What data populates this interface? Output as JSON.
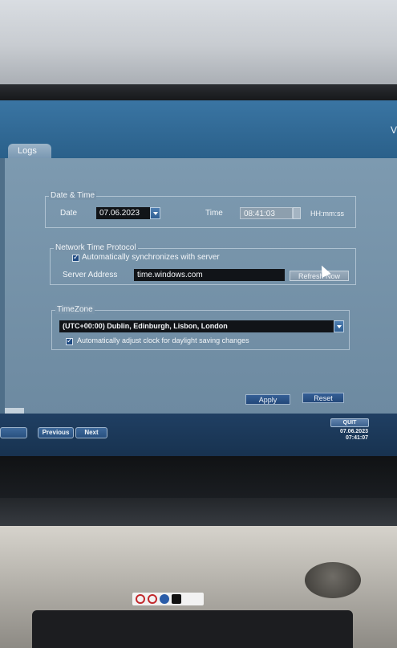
{
  "tabs": {
    "logs": "Logs"
  },
  "corner_char": "V",
  "date_time": {
    "title": "Date & Time",
    "date_label": "Date",
    "date_value": "07.06.2023",
    "time_label": "Time",
    "time_value": "08:41:03",
    "time_format": "HH:mm:ss"
  },
  "ntp": {
    "title": "Network Time Protocol",
    "auto_sync_label": "Automatically synchronizes with server",
    "auto_sync_checked": true,
    "server_label": "Server Address",
    "server_value": "time.windows.com",
    "refresh_label": "Refresh Now"
  },
  "timezone": {
    "title": "TimeZone",
    "selected": "(UTC+00:00) Dublin, Edinburgh, Lisbon, London",
    "dst_label": "Automatically adjust clock for daylight saving changes",
    "dst_checked": true
  },
  "actions": {
    "apply": "Apply",
    "reset": "Reset"
  },
  "nav": {
    "previous": "Previous",
    "next": "Next",
    "quit": "QUIT"
  },
  "status": {
    "date": "07.06.2023",
    "time": "07:41:07"
  },
  "colors": {
    "screen_bg": "#2c6288",
    "panel_bg": "#7d9ab0",
    "button_blue": "#355f96"
  }
}
